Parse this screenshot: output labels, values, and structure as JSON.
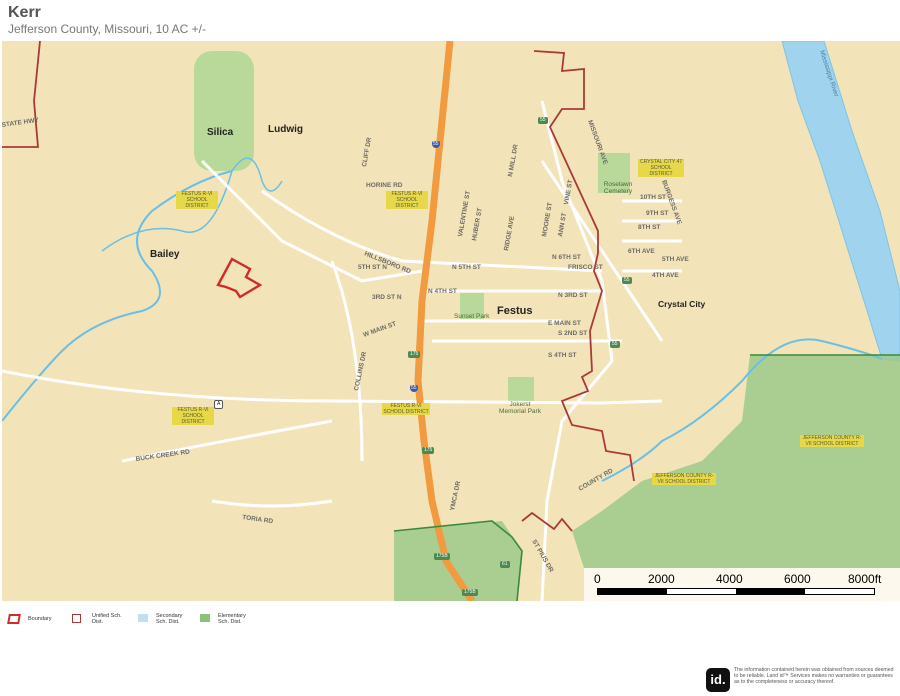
{
  "header": {
    "title": "Kerr",
    "subtitle": "Jefferson County, Missouri, 10 AC +/-"
  },
  "map": {
    "places": [
      {
        "name": "Silica"
      },
      {
        "name": "Ludwig"
      },
      {
        "name": "Bailey"
      },
      {
        "name": "Festus"
      },
      {
        "name": "Crystal City"
      }
    ],
    "streets": [
      "HORINE RD",
      "HILLSBORO RD",
      "N 5TH ST",
      "N 6TH ST",
      "W MAIN ST",
      "E MAIN ST",
      "COLLINS DR",
      "YMCA DR",
      "BUCK CREEK RD",
      "TORIA RD",
      "MISSOURI AVE",
      "8TH ST",
      "5TH ST N",
      "3RD ST N",
      "N 4TH ST",
      "N 3RD ST",
      "S 2ND ST",
      "S 4TH ST",
      "VALENTINE ST",
      "HUBER ST",
      "RIDGE AVE",
      "MOORE ST",
      "ANN ST",
      "VINE ST",
      "CLIFF DR",
      "N MILL DR",
      "FRISCO ST",
      "6TH AVE",
      "5TH AVE",
      "4TH AVE",
      "10TH ST",
      "9TH ST",
      "BURGESS AVE",
      "COUNTY RD",
      "STATE HWY",
      "ST PIUS DR"
    ],
    "parks": [
      "Sunset Park",
      "Jokerst Memorial Park",
      "Roselawn Cemetery"
    ],
    "districts": [
      "FESTUS R-VI SCHOOL DISTRICT",
      "FESTUS R-VI SCHOOL DISTRICT",
      "FESTUS R-VI SCHOOL DISTRICT",
      "FESTUS R-VI SCHOOL DISTRICT",
      "CRYSTAL CITY 47 SCHOOL DISTRICT",
      "JEFFERSON COUNTY R-VII SCHOOL DISTRICT",
      "JEFFERSON COUNTY R-VII SCHOOL DISTRICT"
    ],
    "shields": [
      "55",
      "55",
      "55",
      "55",
      "55",
      "175",
      "175",
      "A",
      "175B",
      "175B",
      "61"
    ],
    "river_label": "Mississippi River"
  },
  "scale": {
    "ticks": [
      "0",
      "2000",
      "4000",
      "6000",
      "8000ft"
    ]
  },
  "legend": {
    "items": [
      {
        "label": "Boundary",
        "color": "#d12a2a"
      },
      {
        "label": "Unified Sch. Dist.",
        "color": "#a03a3a"
      },
      {
        "label": "Secondary Sch. Dist.",
        "color": "#bfe0f2"
      },
      {
        "label": "Elementary Sch. Dist.",
        "color": "#8ec07c"
      }
    ]
  },
  "footer": {
    "logo": "id.",
    "disclaimer": "The information contained herein was obtained from sources deemed to be reliable. Land id™ Services makes no warranties or guarantees as to the completeness or accuracy thereof."
  }
}
